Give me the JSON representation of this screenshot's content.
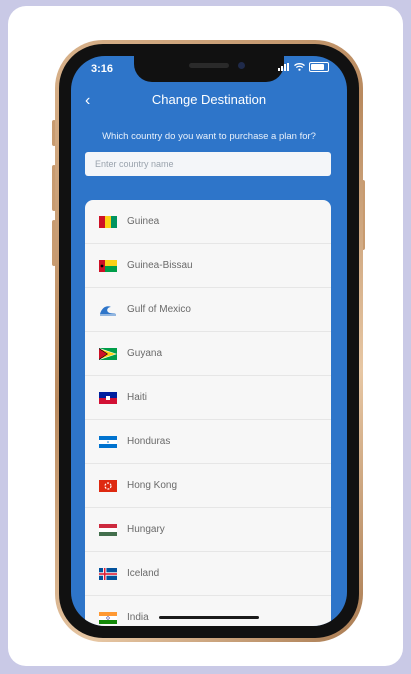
{
  "status_bar": {
    "time": "3:16"
  },
  "nav": {
    "back_label": "‹",
    "title": "Change Destination"
  },
  "prompt": {
    "question": "Which country do you want to purchase a plan for?"
  },
  "search": {
    "placeholder": "Enter country name",
    "value": ""
  },
  "countries": [
    {
      "name": "Guinea",
      "flag_icon": "guinea-flag-icon"
    },
    {
      "name": "Guinea-Bissau",
      "flag_icon": "guinea-bissau-flag-icon"
    },
    {
      "name": "Gulf of Mexico",
      "flag_icon": "gulf-of-mexico-wave-icon"
    },
    {
      "name": "Guyana",
      "flag_icon": "guyana-flag-icon"
    },
    {
      "name": "Haiti",
      "flag_icon": "haiti-flag-icon"
    },
    {
      "name": "Honduras",
      "flag_icon": "honduras-flag-icon"
    },
    {
      "name": "Hong Kong",
      "flag_icon": "hong-kong-flag-icon"
    },
    {
      "name": "Hungary",
      "flag_icon": "hungary-flag-icon"
    },
    {
      "name": "Iceland",
      "flag_icon": "iceland-flag-icon"
    },
    {
      "name": "India",
      "flag_icon": "india-flag-icon"
    }
  ],
  "colors": {
    "page_background": "#c9c9e6",
    "app_background": "#2e75c9",
    "list_background": "#f7f7f7",
    "row_text": "#6a6a6a"
  }
}
